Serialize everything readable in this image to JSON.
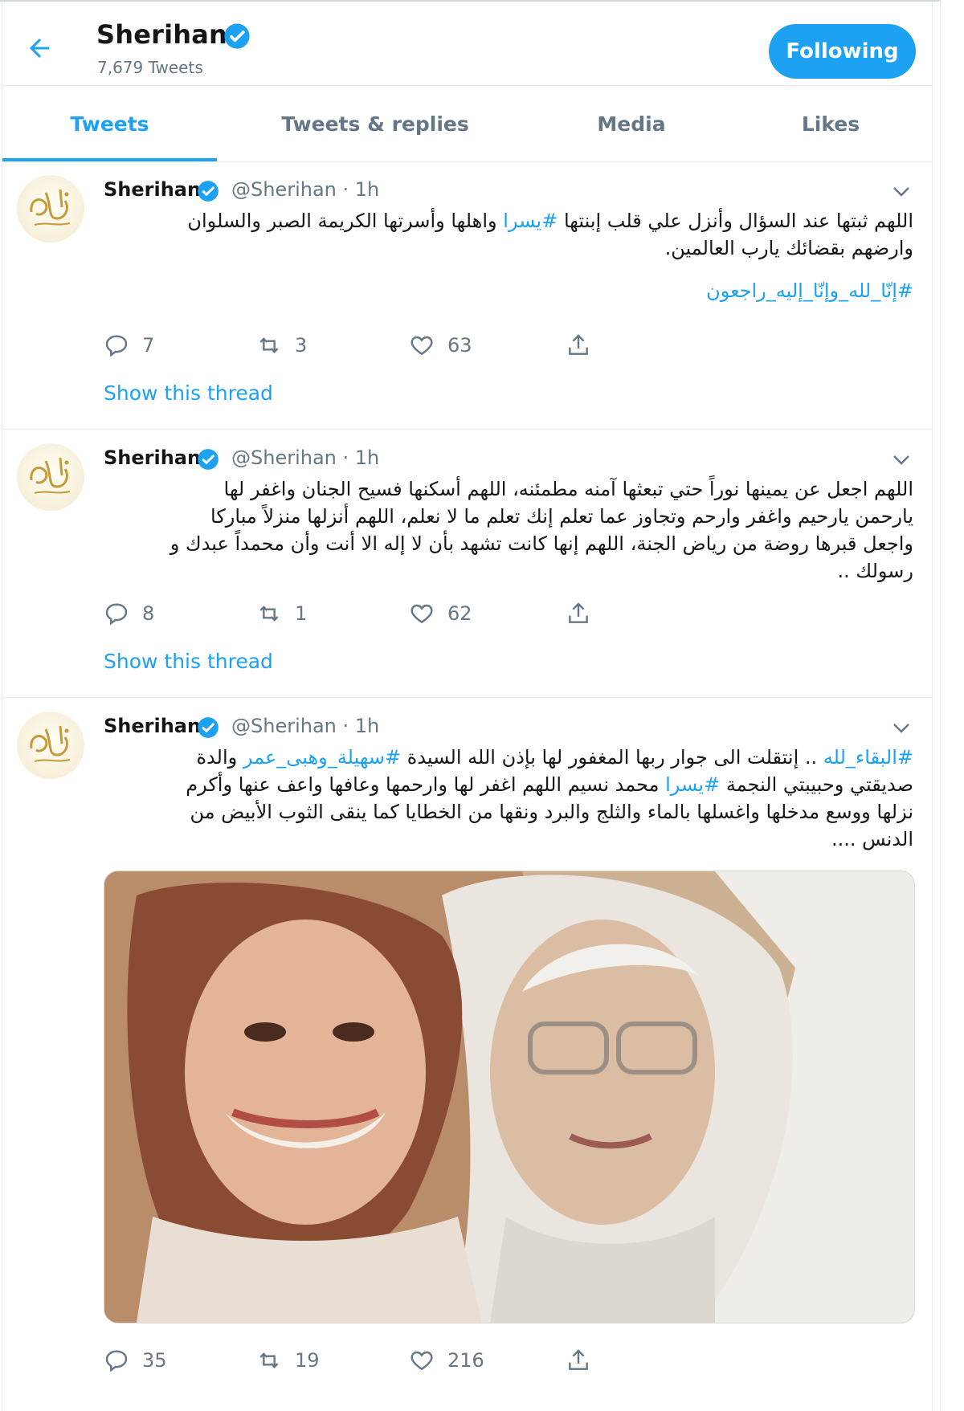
{
  "header": {
    "name": "Sherihan",
    "tweet_count": "7,679 Tweets",
    "follow_label": "Following"
  },
  "tabs": [
    {
      "label": "Tweets",
      "active": true
    },
    {
      "label": "Tweets & replies",
      "active": false
    },
    {
      "label": "Media",
      "active": false
    },
    {
      "label": "Likes",
      "active": false
    }
  ],
  "tweets": [
    {
      "author": "Sherihan",
      "meta": "@Sherihan · 1h",
      "lines": [
        {
          "before": "اللهم ثبتها عند السؤال وأنزل علي قلب إبنتها ",
          "tag": "#يسرا",
          "after": " واهلها وأسرتها الكريمة الصبر والسلوان"
        },
        {
          "before": "وارضهم بقضائك يارب العالمين.",
          "tag": "",
          "after": ""
        }
      ],
      "hashtag_line": "#إنّا_لله_وإنّا_إليه_راجعون",
      "replies": "7",
      "retweets": "3",
      "likes": "63",
      "show_thread": "Show this thread"
    },
    {
      "author": "Sherihan",
      "meta": "@Sherihan · 1h",
      "lines": [
        {
          "before": "اللهم اجعل عن يمينها نوراً حتي تبعثها آمنه مطمئنه، اللهم أسكنها فسيح الجنان واغفر لها",
          "tag": "",
          "after": ""
        },
        {
          "before": "يارحمن يارحيم واغفر وارحم وتجاوز عما تعلم إنك تعلم ما لا نعلم، اللهم أنزلها منزلاً مباركا",
          "tag": "",
          "after": ""
        },
        {
          "before": "واجعل قبرها روضة من رياض الجنة، اللهم إنها كانت تشهد بأن لا إله الا أنت وأن محمداً عبدك و",
          "tag": "",
          "after": ""
        },
        {
          "before": "رسولك ..",
          "tag": "",
          "after": ""
        }
      ],
      "replies": "8",
      "retweets": "1",
      "likes": "62",
      "show_thread": "Show this thread"
    },
    {
      "author": "Sherihan",
      "meta": "@Sherihan · 1h",
      "lines": [
        {
          "tag1": "#البقاء_لله",
          "mid": " .. إنتقلت الى جوار ربها المغفور لها بإذن الله السيدة ",
          "tag2": "#سهيلة_وهبى_عمر",
          "after": " والدة"
        },
        {
          "before": "صديقتي وحبيبتي النجمة ",
          "tag": "#يسرا",
          "after": " محمد نسيم اللهم اغفر لها وارحمها وعافها واعف عنها وأكرم"
        },
        {
          "before": "نزلها ووسع مدخلها واغسلها بالماء والثلج والبرد ونقها من الخطايا كما ينقى الثوب الأبيض من",
          "tag": "",
          "after": ""
        },
        {
          "before": "الدنس ....",
          "tag": "",
          "after": ""
        }
      ],
      "replies": "35",
      "retweets": "19",
      "likes": "216"
    }
  ],
  "colors": {
    "accent": "#1da1f2",
    "muted": "#657786",
    "text": "#14171a"
  }
}
